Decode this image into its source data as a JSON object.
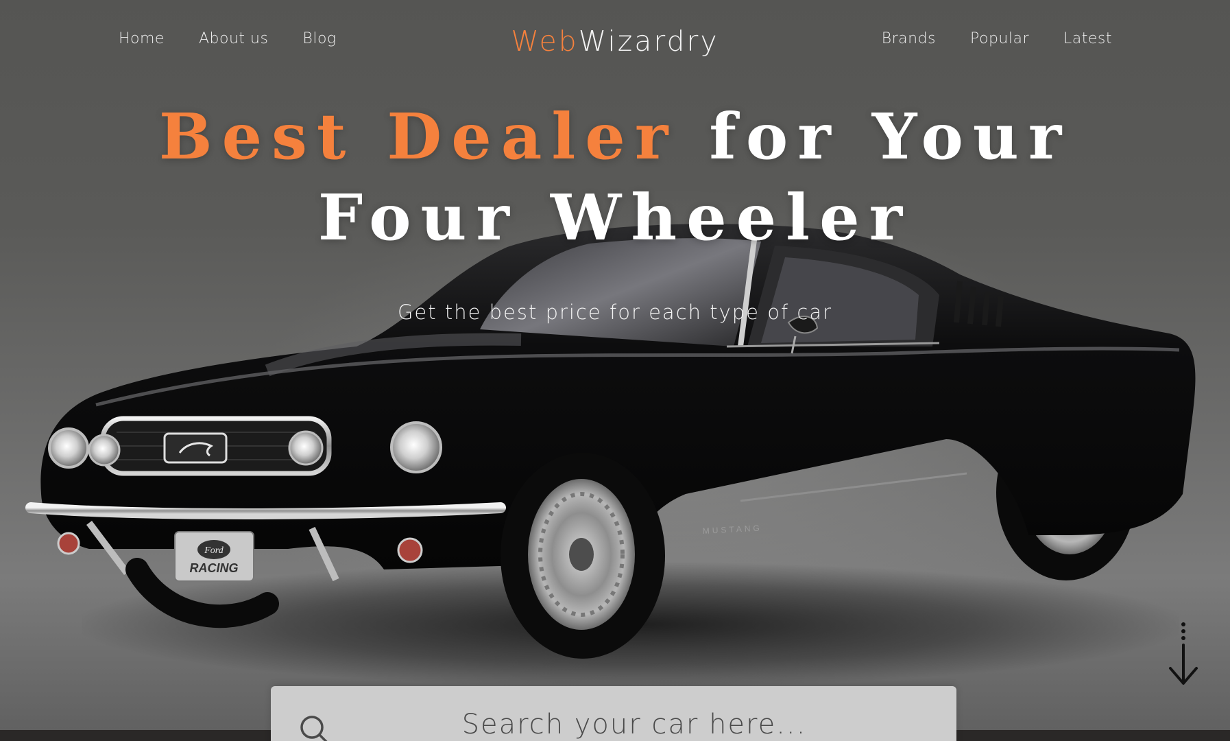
{
  "nav": {
    "left": [
      {
        "label": "Home"
      },
      {
        "label": "About us"
      },
      {
        "label": "Blog"
      }
    ],
    "right": [
      {
        "label": "Brands"
      },
      {
        "label": "Popular"
      },
      {
        "label": "Latest"
      }
    ]
  },
  "logo": {
    "accent": "Web",
    "rest": "Wizardry"
  },
  "hero": {
    "headline_accent": "Best Dealer",
    "headline_rest_line1": " for Your",
    "headline_line2": "Four Wheeler",
    "subtitle": "Get the best price for each type of car"
  },
  "search": {
    "placeholder": "Search your car here..."
  },
  "car_plate": {
    "line1": "Ford",
    "line2": "RACING"
  },
  "icons": {
    "search": "search-icon",
    "scroll": "arrow-down-icon"
  },
  "colors": {
    "accent": "#f5813d",
    "text": "#ffffff",
    "search_bg": "#cdcdcd"
  }
}
